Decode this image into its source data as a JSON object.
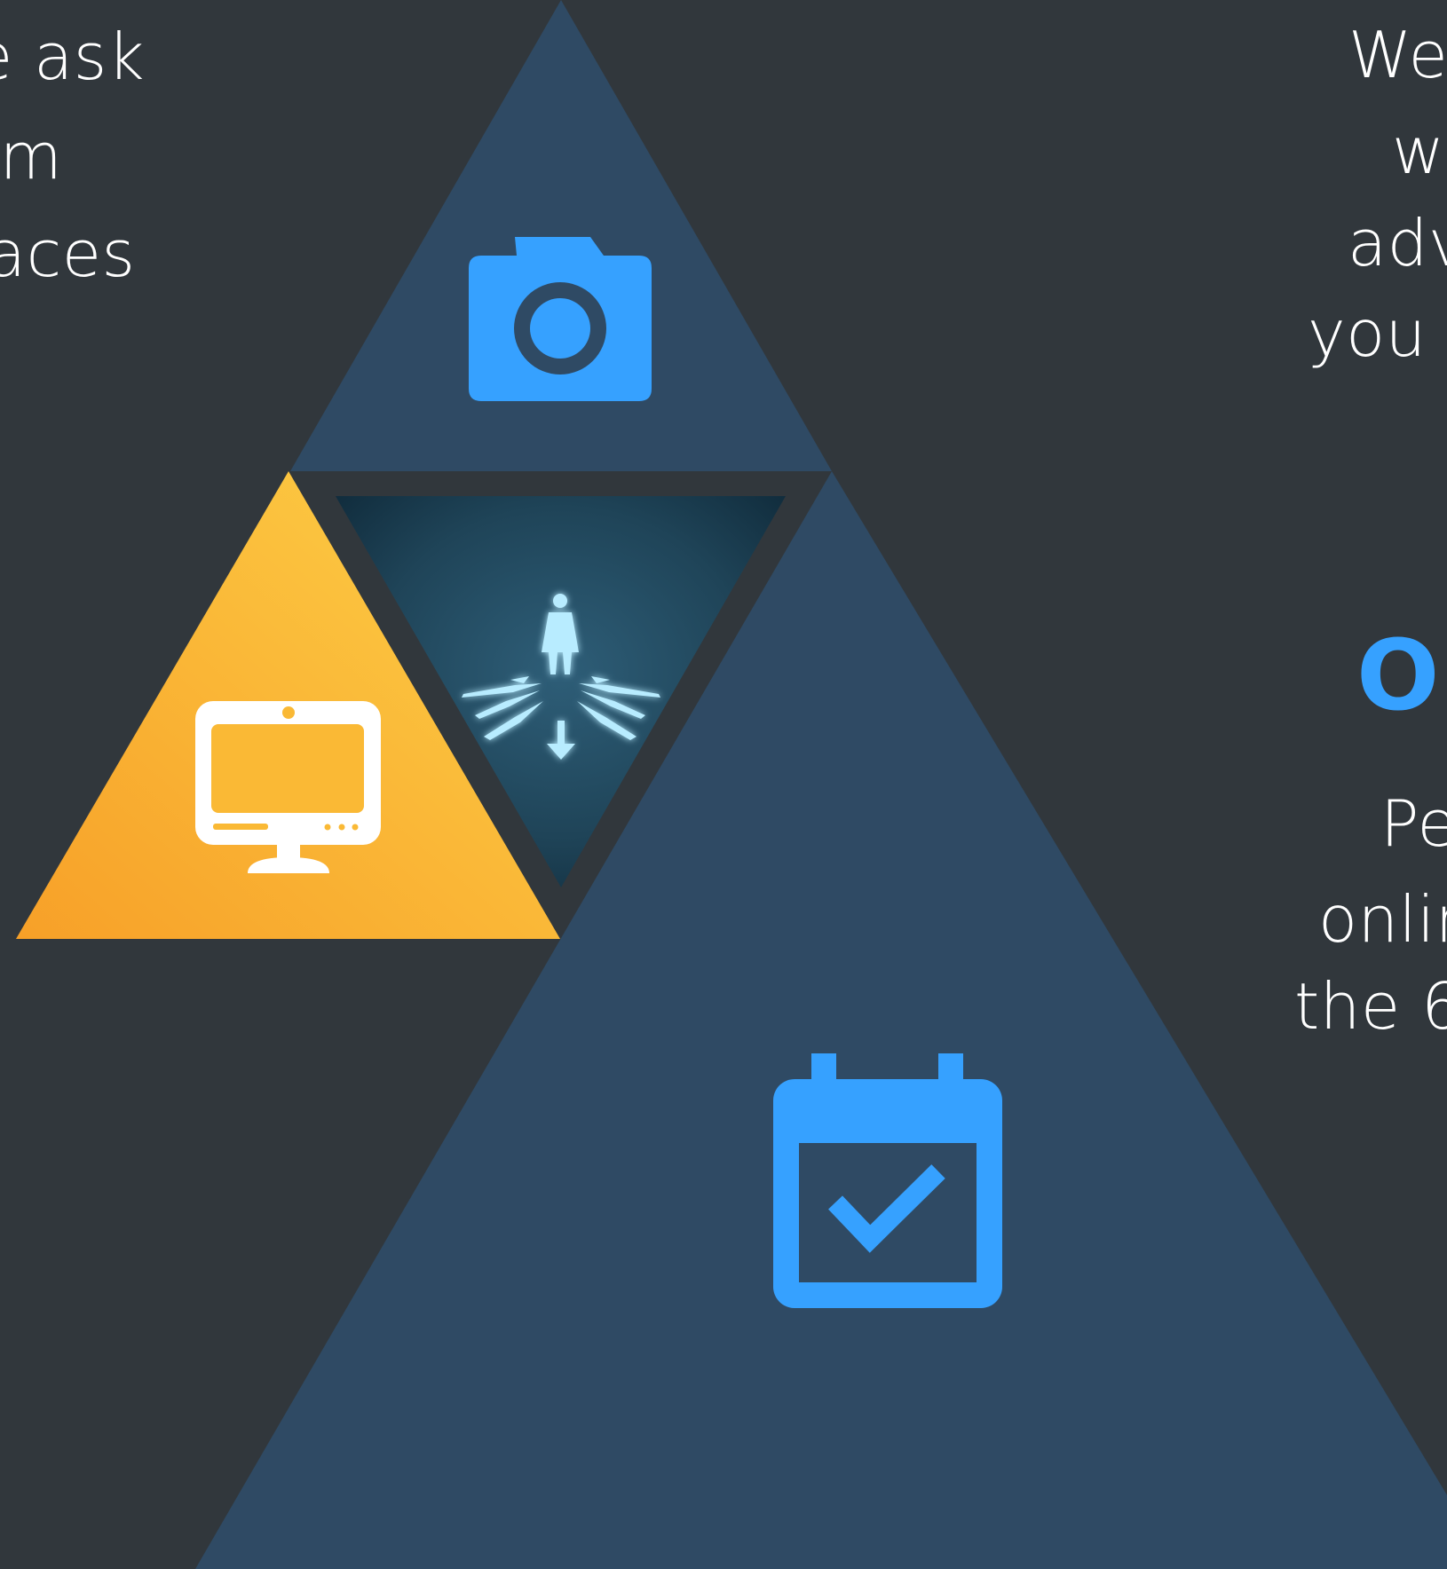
{
  "left_text": {
    "line1": "e ask",
    "line2": "am",
    "line3": "aces"
  },
  "right_text": {
    "line1": "We",
    "line2": "wi",
    "line3": "adv",
    "line4": "you t"
  },
  "right_heading": "Op",
  "right_paragraph": {
    "line1": "Pe",
    "line2": "onlin",
    "line3": "the 6"
  },
  "colors": {
    "background": "#31373c",
    "triangle_dark": "#2f4a64",
    "triangle_gold": "#fbbf3c",
    "accent_blue": "#36a1ff"
  },
  "icons": {
    "top": "camera-icon",
    "left": "monitor-icon",
    "center": "businessman-crossroads-image",
    "bottom": "calendar-check-icon"
  }
}
